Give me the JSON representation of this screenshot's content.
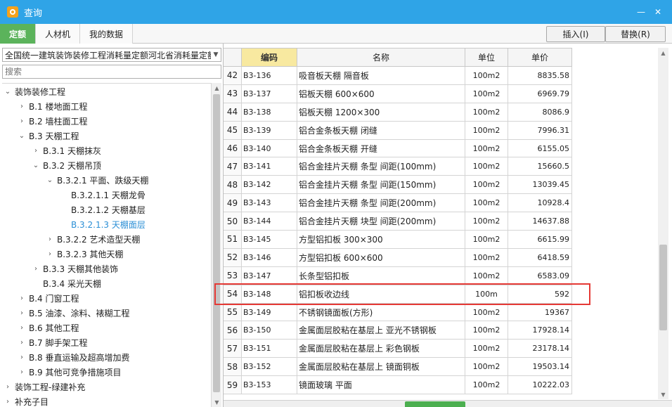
{
  "window": {
    "title": "查询",
    "minimize": "—",
    "close": "✕"
  },
  "tabs": [
    {
      "label": "定额",
      "active": true
    },
    {
      "label": "人材机",
      "active": false
    },
    {
      "label": "我的数据",
      "active": false
    }
  ],
  "actions": {
    "insert": "插入(I)",
    "replace": "替换(R)"
  },
  "left": {
    "library": "全国统一建筑装饰装修工程消耗量定额河北省消耗量定额",
    "search_placeholder": "搜索",
    "tree": [
      {
        "label": "装饰装修工程",
        "depth": 0,
        "toggle": "expanded"
      },
      {
        "label": "B.1 楼地面工程",
        "depth": 1,
        "toggle": "collapsed"
      },
      {
        "label": "B.2 墙柱面工程",
        "depth": 1,
        "toggle": "collapsed"
      },
      {
        "label": "B.3 天棚工程",
        "depth": 1,
        "toggle": "expanded"
      },
      {
        "label": "B.3.1 天棚抹灰",
        "depth": 2,
        "toggle": "collapsed"
      },
      {
        "label": "B.3.2 天棚吊顶",
        "depth": 2,
        "toggle": "expanded"
      },
      {
        "label": "B.3.2.1 平面、跌级天棚",
        "depth": 3,
        "toggle": "expanded"
      },
      {
        "label": "B.3.2.1.1 天棚龙骨",
        "depth": 4,
        "toggle": "none"
      },
      {
        "label": "B.3.2.1.2 天棚基层",
        "depth": 4,
        "toggle": "none"
      },
      {
        "label": "B.3.2.1.3 天棚面层",
        "depth": 4,
        "toggle": "none",
        "selected": true
      },
      {
        "label": "B.3.2.2 艺术造型天棚",
        "depth": 3,
        "toggle": "collapsed"
      },
      {
        "label": "B.3.2.3 其他天棚",
        "depth": 3,
        "toggle": "collapsed"
      },
      {
        "label": "B.3.3 天棚其他装饰",
        "depth": 2,
        "toggle": "collapsed"
      },
      {
        "label": "B.3.4 采光天棚",
        "depth": 2,
        "toggle": "none"
      },
      {
        "label": "B.4 门窗工程",
        "depth": 1,
        "toggle": "collapsed"
      },
      {
        "label": "B.5 油漆、涂料、裱糊工程",
        "depth": 1,
        "toggle": "collapsed"
      },
      {
        "label": "B.6 其他工程",
        "depth": 1,
        "toggle": "collapsed"
      },
      {
        "label": "B.7 脚手架工程",
        "depth": 1,
        "toggle": "collapsed"
      },
      {
        "label": "B.8 垂直运输及超高增加费",
        "depth": 1,
        "toggle": "collapsed"
      },
      {
        "label": "B.9 其他可竞争措施项目",
        "depth": 1,
        "toggle": "collapsed"
      },
      {
        "label": "装饰工程-绿建补充",
        "depth": 0,
        "toggle": "collapsed"
      },
      {
        "label": "补充子目",
        "depth": 0,
        "toggle": "collapsed"
      }
    ]
  },
  "grid": {
    "columns": {
      "code": "编码",
      "name": "名称",
      "unit": "单位",
      "price": "单价"
    },
    "rows": [
      {
        "idx": "42",
        "code": "B3-136",
        "name": "吸音板天棚 隔音板",
        "unit": "100m2",
        "price": "8835.58"
      },
      {
        "idx": "43",
        "code": "B3-137",
        "name": "铝板天棚 600×600",
        "unit": "100m2",
        "price": "6969.79"
      },
      {
        "idx": "44",
        "code": "B3-138",
        "name": "铝板天棚 1200×300",
        "unit": "100m2",
        "price": "8086.9"
      },
      {
        "idx": "45",
        "code": "B3-139",
        "name": "铝合金条板天棚 闭缝",
        "unit": "100m2",
        "price": "7996.31"
      },
      {
        "idx": "46",
        "code": "B3-140",
        "name": "铝合金条板天棚 开缝",
        "unit": "100m2",
        "price": "6155.05"
      },
      {
        "idx": "47",
        "code": "B3-141",
        "name": "铝合金挂片天棚 条型 间距(100mm)",
        "unit": "100m2",
        "price": "15660.5"
      },
      {
        "idx": "48",
        "code": "B3-142",
        "name": "铝合金挂片天棚 条型 间距(150mm)",
        "unit": "100m2",
        "price": "13039.45"
      },
      {
        "idx": "49",
        "code": "B3-143",
        "name": "铝合金挂片天棚 条型 间距(200mm)",
        "unit": "100m2",
        "price": "10928.4"
      },
      {
        "idx": "50",
        "code": "B3-144",
        "name": "铝合金挂片天棚 块型 间距(200mm)",
        "unit": "100m2",
        "price": "14637.88"
      },
      {
        "idx": "51",
        "code": "B3-145",
        "name": "方型铝扣板 300×300",
        "unit": "100m2",
        "price": "6615.99"
      },
      {
        "idx": "52",
        "code": "B3-146",
        "name": "方型铝扣板 600×600",
        "unit": "100m2",
        "price": "6418.59"
      },
      {
        "idx": "53",
        "code": "B3-147",
        "name": "长条型铝扣板",
        "unit": "100m2",
        "price": "6583.09"
      },
      {
        "idx": "54",
        "code": "B3-148",
        "name": "铝扣板收边线",
        "unit": "100m",
        "price": "592"
      },
      {
        "idx": "55",
        "code": "B3-149",
        "name": "不锈钢镜面板(方形)",
        "unit": "100m2",
        "price": "19367"
      },
      {
        "idx": "56",
        "code": "B3-150",
        "name": "金属面层胶粘在基层上 亚光不锈钢板",
        "unit": "100m2",
        "price": "17928.14"
      },
      {
        "idx": "57",
        "code": "B3-151",
        "name": "金属面层胶粘在基层上 彩色钢板",
        "unit": "100m2",
        "price": "23178.14"
      },
      {
        "idx": "58",
        "code": "B3-152",
        "name": "金属面层胶粘在基层上 镜面铜板",
        "unit": "100m2",
        "price": "19503.14"
      },
      {
        "idx": "59",
        "code": "B3-153",
        "name": "镜面玻璃 平面",
        "unit": "100m2",
        "price": "10222.03"
      }
    ]
  }
}
